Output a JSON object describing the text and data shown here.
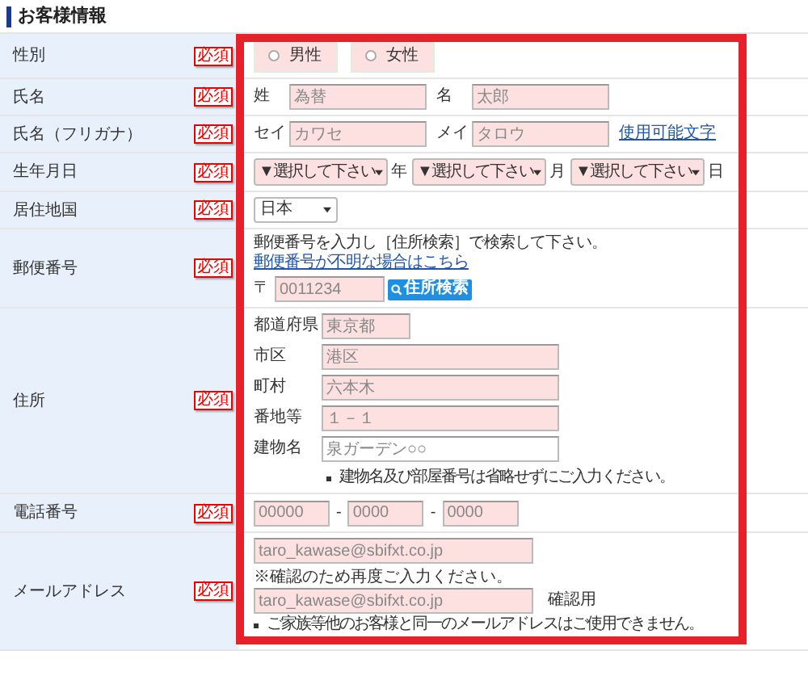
{
  "section_title": "お客様情報",
  "rows": [
    {
      "kind": "gender",
      "label": "性別",
      "badge": "必須",
      "options": [
        {
          "label": "男性",
          "selected": false
        },
        {
          "label": "女性",
          "selected": false
        }
      ]
    },
    {
      "kind": "name",
      "label": "氏名",
      "badge": "必須",
      "fields": [
        {
          "prefix": "姓",
          "placeholder": "為替"
        },
        {
          "prefix": "名",
          "placeholder": "太郎"
        }
      ]
    },
    {
      "kind": "name",
      "label": "氏名（フリガナ）",
      "badge": "必須",
      "fields": [
        {
          "prefix": "セイ",
          "placeholder": "カワセ"
        },
        {
          "prefix": "メイ",
          "placeholder": "タロウ"
        }
      ],
      "link": "使用可能文字"
    },
    {
      "kind": "date",
      "label": "生年月日",
      "badge": "必須",
      "selects": [
        {
          "value": "▼選択して下さい",
          "suffix": "年"
        },
        {
          "value": "▼選択して下さい",
          "suffix": "月"
        },
        {
          "value": "▼選択して下さい",
          "suffix": "日"
        }
      ]
    },
    {
      "kind": "country",
      "label": "居住地国",
      "badge": "必須",
      "value": "日本"
    },
    {
      "kind": "postal",
      "label": "郵便番号",
      "badge": "必須",
      "instruction": "郵便番号を入力し［住所検索］で検索して下さい。",
      "link": "郵便番号が不明な場合はこちら",
      "prefix": "〒",
      "placeholder": "0011234",
      "button": "住所検索"
    },
    {
      "kind": "address",
      "label": "住所",
      "badge": "必須",
      "fields": [
        {
          "label": "都道府県",
          "placeholder": "東京都",
          "highlighted": true
        },
        {
          "label": "市区",
          "placeholder": "港区",
          "highlighted": true
        },
        {
          "label": "町村",
          "placeholder": "六本木",
          "highlighted": true
        },
        {
          "label": "番地等",
          "placeholder": "１－１",
          "highlighted": true
        },
        {
          "label": "建物名",
          "placeholder": "泉ガーデン○○",
          "highlighted": false
        }
      ],
      "note": "建物名及び部屋番号は省略せずにご入力ください。"
    },
    {
      "kind": "phone",
      "label": "電話番号",
      "badge": "必須",
      "fields": [
        {
          "placeholder": "00000"
        },
        {
          "placeholder": "0000"
        },
        {
          "placeholder": "0000"
        }
      ],
      "separators": [
        "-",
        "-"
      ]
    },
    {
      "kind": "email",
      "label": "メールアドレス",
      "badge": "必須",
      "placeholder": "taro_kawase@sbifxt.co.jp",
      "confirm_note": "※確認のため再度ご入力ください。",
      "confirm_placeholder": "taro_kawase@sbifxt.co.jp",
      "confirm_suffix": "確認用",
      "note": "ご家族等他のお客様と同一のメールアドレスはご使用できません。"
    }
  ]
}
